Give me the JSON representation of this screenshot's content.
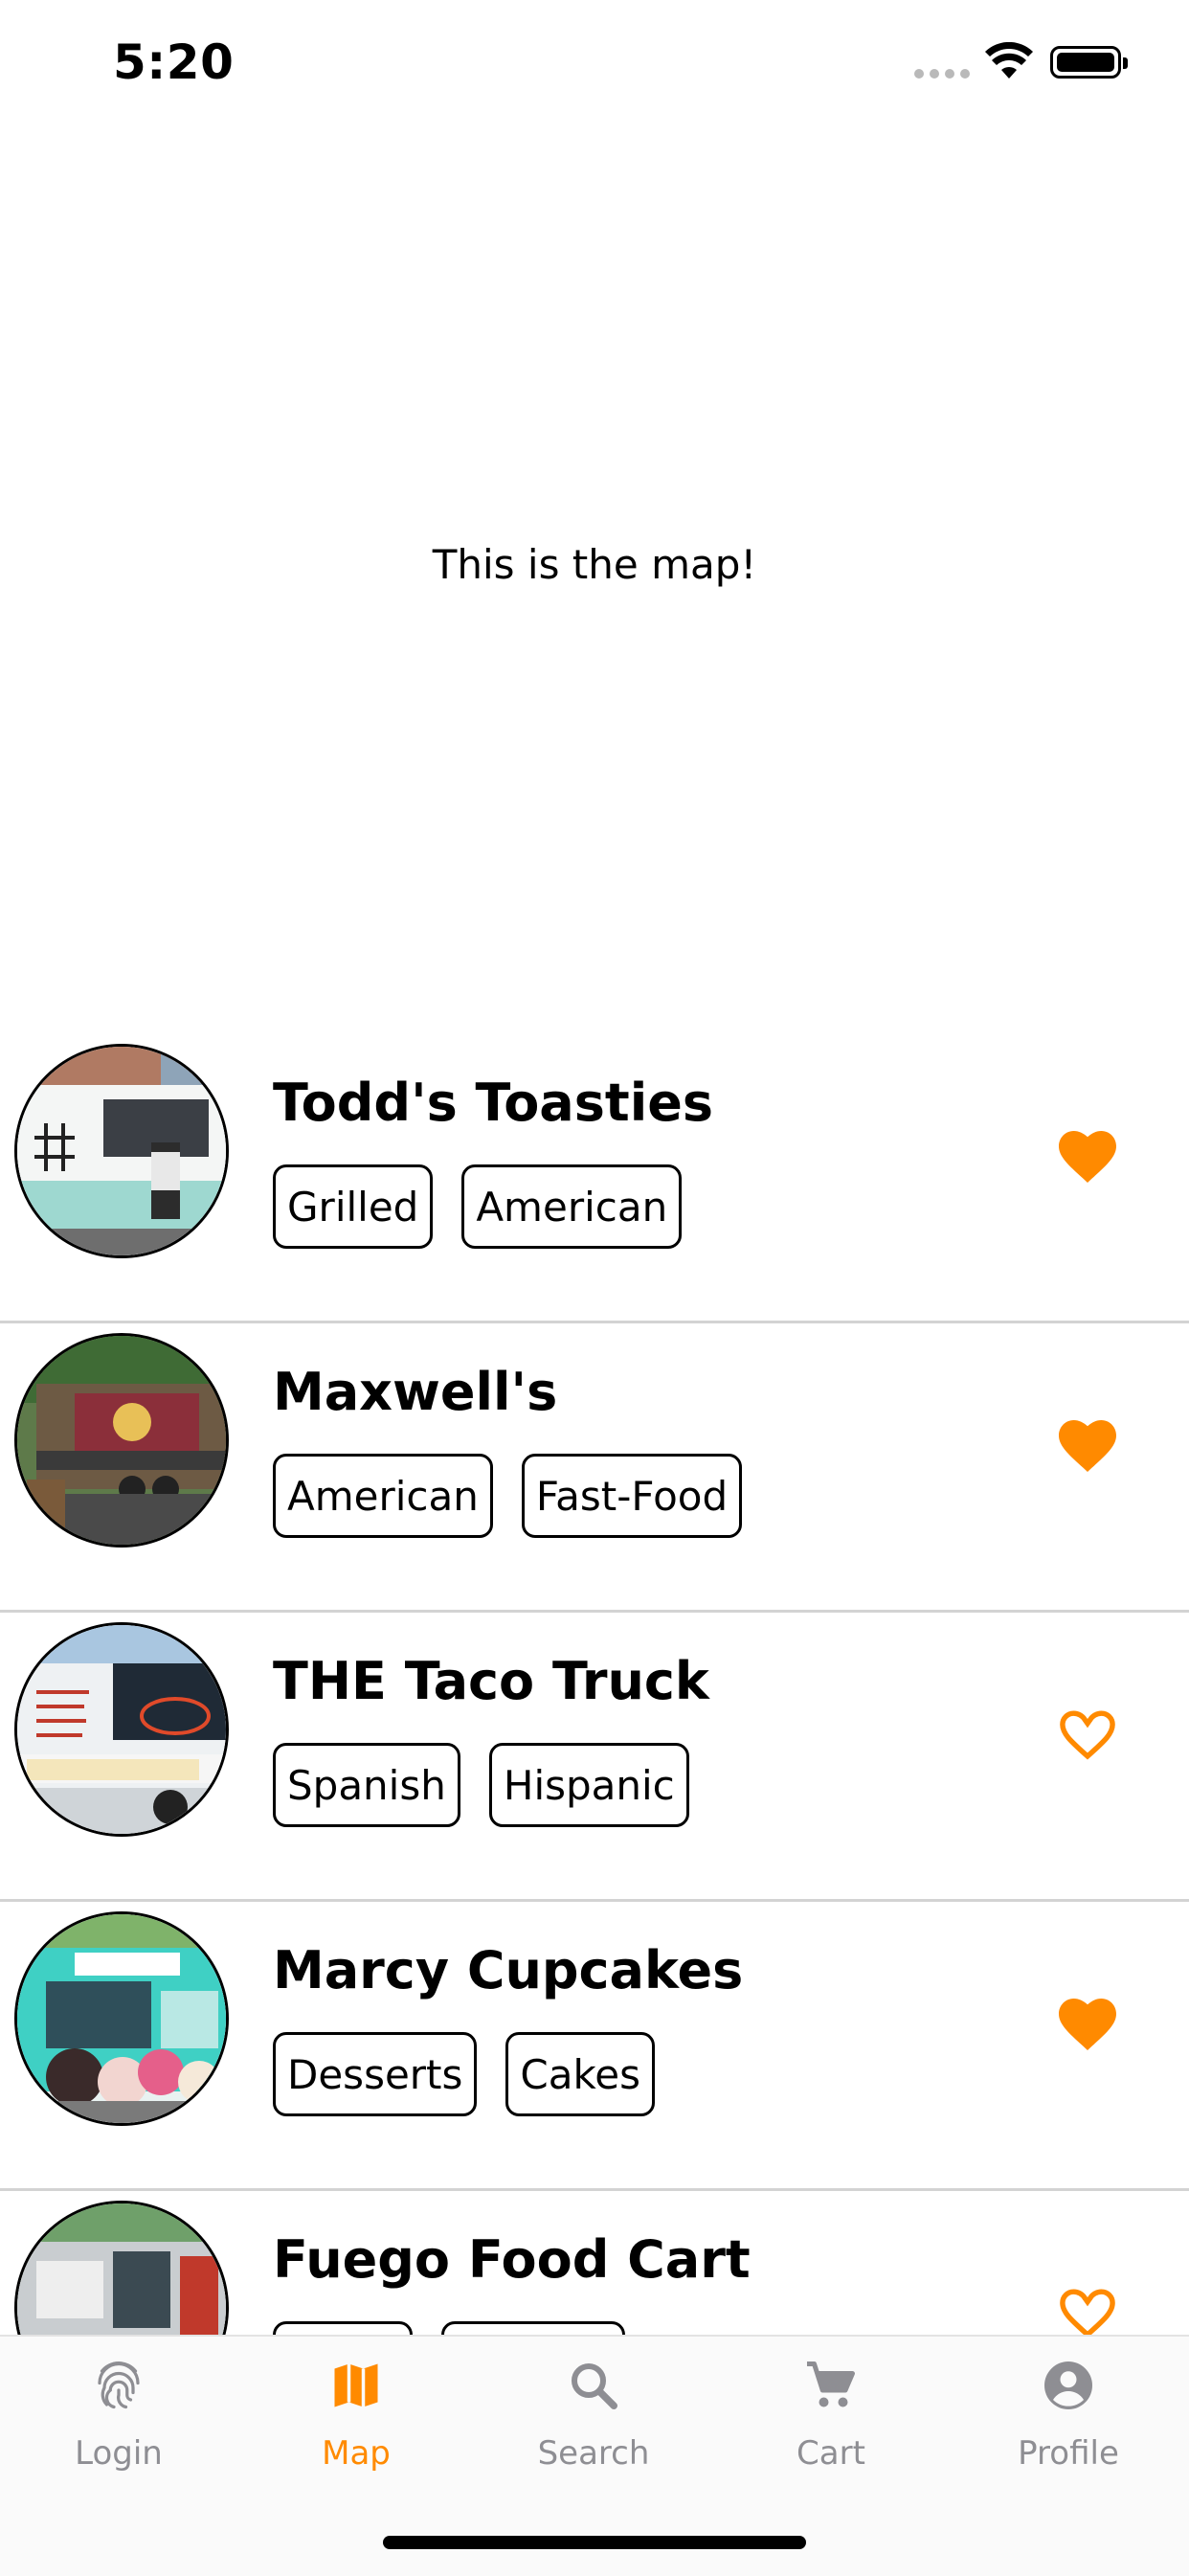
{
  "status_bar": {
    "time": "5:20"
  },
  "map": {
    "text": "This is the map!"
  },
  "trucks": [
    {
      "name": "Todd's Toasties",
      "tags": [
        "Grilled",
        "American"
      ],
      "favorite": true
    },
    {
      "name": "Maxwell's",
      "tags": [
        "American",
        "Fast-Food"
      ],
      "favorite": true
    },
    {
      "name": "THE Taco Truck",
      "tags": [
        "Spanish",
        "Hispanic"
      ],
      "favorite": false
    },
    {
      "name": "Marcy Cupcakes",
      "tags": [
        "Desserts",
        "Cakes"
      ],
      "favorite": true
    },
    {
      "name": "Fuego Food Cart",
      "tags": [
        "",
        ""
      ],
      "favorite": false
    }
  ],
  "tab_bar": {
    "tabs": [
      {
        "label": "Login",
        "icon": "fingerprint-icon",
        "active": false
      },
      {
        "label": "Map",
        "icon": "map-icon",
        "active": true
      },
      {
        "label": "Search",
        "icon": "search-icon",
        "active": false
      },
      {
        "label": "Cart",
        "icon": "cart-icon",
        "active": false
      },
      {
        "label": "Profile",
        "icon": "profile-icon",
        "active": false
      }
    ]
  },
  "colors": {
    "accent": "#ff8a00",
    "inactive": "#8e8e93",
    "divider": "#d3d3d3"
  }
}
